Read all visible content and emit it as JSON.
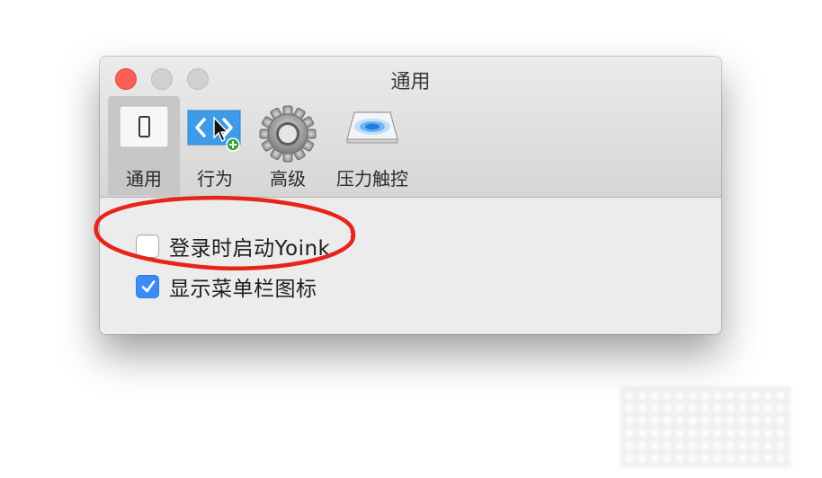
{
  "window": {
    "title": "通用"
  },
  "toolbar": {
    "tabs": [
      {
        "label": "通用",
        "icon": "general-switch-icon",
        "selected": true
      },
      {
        "label": "行为",
        "icon": "behavior-arrows-icon",
        "selected": false
      },
      {
        "label": "高级",
        "icon": "gear-icon",
        "selected": false
      },
      {
        "label": "压力触控",
        "icon": "force-touch-trackpad-icon",
        "selected": false
      }
    ]
  },
  "settings": {
    "launch_at_login": {
      "label": "登录时启动Yoink",
      "checked": false
    },
    "show_menubar_icon": {
      "label": "显示菜单栏图标",
      "checked": true
    }
  },
  "colors": {
    "annotation_circle": "#e8231a",
    "checkbox_checked": "#3b8cf5",
    "close_button": "#fc5f57"
  }
}
